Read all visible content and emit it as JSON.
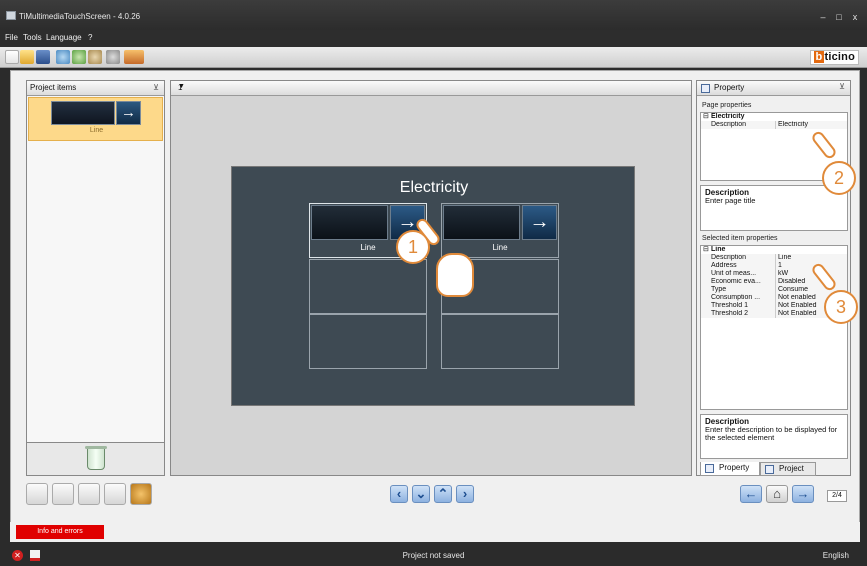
{
  "window": {
    "title": "TiMultimediaTouchScreen - 4.0.26"
  },
  "menu": {
    "items": [
      "File",
      "Tools",
      "Language",
      "?"
    ]
  },
  "toolbar": {
    "icons": [
      "new-file-icon",
      "open-folder-icon",
      "save-icon",
      "send-icon",
      "receive-icon",
      "tools-icon",
      "settings-icon",
      "language-icon"
    ],
    "brand": {
      "first_letter": "b",
      "rest": "ticino"
    }
  },
  "project_items": {
    "title": "Project items",
    "items": [
      {
        "label": "Line"
      }
    ]
  },
  "editor": {
    "page_number": "1",
    "page_title": "Electricity",
    "cells": [
      {
        "label": "Line"
      },
      {
        "label": "Line"
      }
    ]
  },
  "property": {
    "title": "Property",
    "page_properties_label": "Page properties",
    "page_group": "Electricity",
    "page_rows": [
      {
        "key": "Description",
        "value": "Electricity"
      }
    ],
    "page_desc_title": "Description",
    "page_desc_text": "Enter page title",
    "selected_label": "Selected item properties",
    "item_group": "Line",
    "item_rows": [
      {
        "key": "Description",
        "value": "Line"
      },
      {
        "key": "Address",
        "value": "1"
      },
      {
        "key": "Unit of meas...",
        "value": "kW"
      },
      {
        "key": "Economic eva...",
        "value": "Disabled"
      },
      {
        "key": "Type",
        "value": "Consume"
      },
      {
        "key": "Consumption ...",
        "value": "Not enabled"
      },
      {
        "key": "Threshold 1",
        "value": "Not Enabled"
      },
      {
        "key": "Threshold 2",
        "value": "Not Enabled"
      }
    ],
    "item_desc_title": "Description",
    "item_desc_text": "Enter the description to be displayed for the selected element",
    "tabs": [
      "Property",
      "Project"
    ]
  },
  "bottom": {
    "pager": "2/4"
  },
  "info": {
    "button": "Info and errors"
  },
  "status": {
    "message": "Project not saved",
    "language": "English"
  },
  "callouts": [
    "1",
    "2",
    "3"
  ]
}
